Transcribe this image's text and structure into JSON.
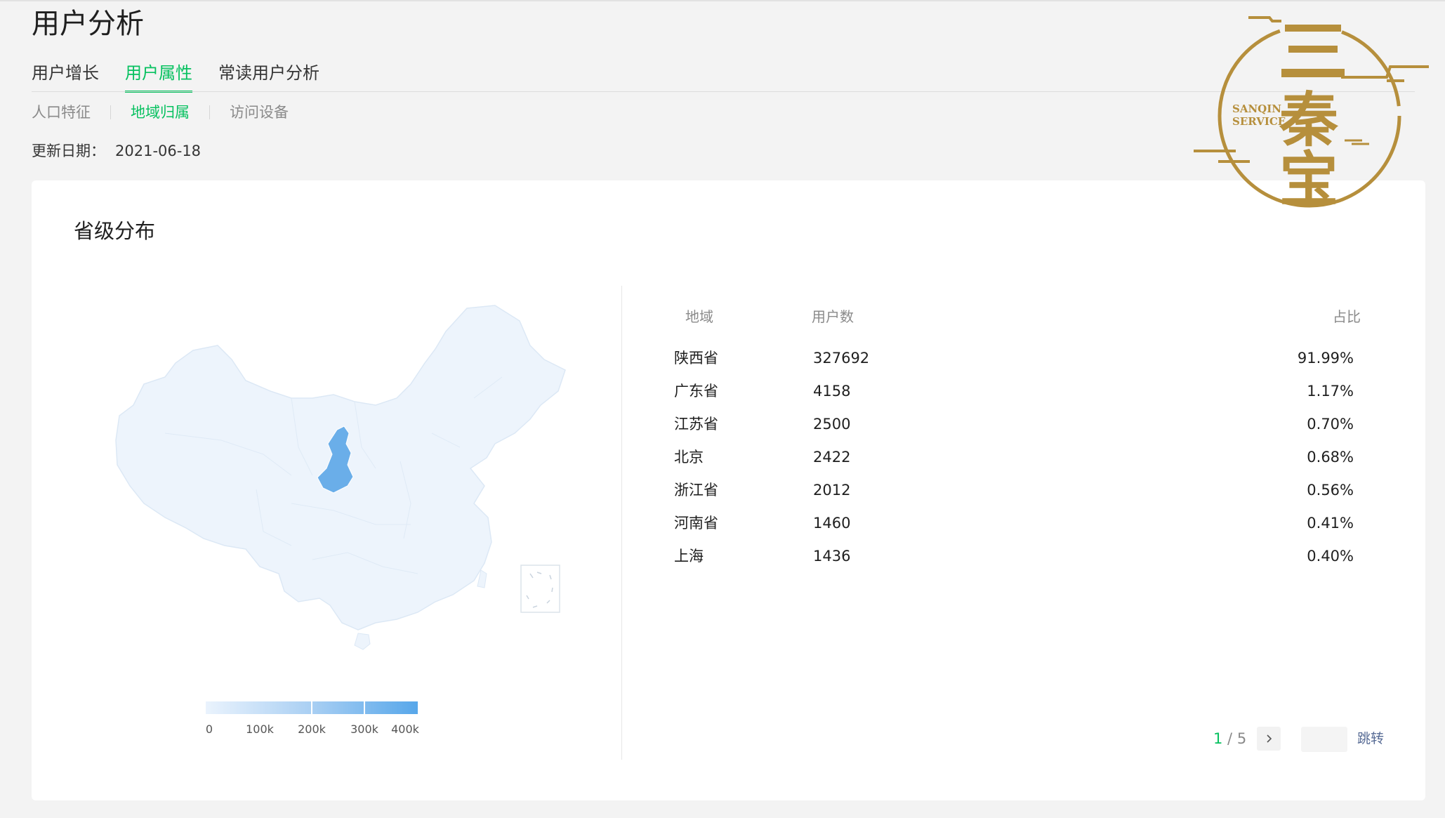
{
  "page": {
    "title": "用户分析"
  },
  "tabs": [
    {
      "label": "用户增长",
      "active": false
    },
    {
      "label": "用户属性",
      "active": true
    },
    {
      "label": "常读用户分析",
      "active": false
    }
  ],
  "subtabs": [
    {
      "label": "人口特征",
      "active": false
    },
    {
      "label": "地域归属",
      "active": true
    },
    {
      "label": "访问设备",
      "active": false
    }
  ],
  "update": {
    "label": "更新日期：",
    "date": "2021-06-18"
  },
  "card": {
    "title": "省级分布"
  },
  "map": {
    "highlighted_region": "陕西省",
    "legend_labels": [
      "0",
      "100k",
      "200k",
      "300k",
      "400k"
    ],
    "colors": {
      "low": "#eaf3fd",
      "high": "#57a7ea",
      "base": "#edf4fc"
    }
  },
  "table": {
    "headers": {
      "region": "地域",
      "users": "用户数",
      "share": "占比"
    },
    "rows": [
      {
        "region": "陕西省",
        "users": "327692",
        "share": "91.99%"
      },
      {
        "region": "广东省",
        "users": "4158",
        "share": "1.17%"
      },
      {
        "region": "江苏省",
        "users": "2500",
        "share": "0.70%"
      },
      {
        "region": "北京",
        "users": "2422",
        "share": "0.68%"
      },
      {
        "region": "浙江省",
        "users": "2012",
        "share": "0.56%"
      },
      {
        "region": "河南省",
        "users": "1460",
        "share": "0.41%"
      },
      {
        "region": "上海",
        "users": "1436",
        "share": "0.40%"
      }
    ]
  },
  "pagination": {
    "current": "1",
    "total": "5",
    "separator": " / ",
    "next_icon": "chevron-right-icon",
    "jump_label": "跳转"
  },
  "watermark": {
    "brand_text": "三秦宝",
    "en_line1": "SANQIN",
    "en_line2": "SERVICE"
  },
  "theme": {
    "accent": "#07c160",
    "link": "#576b95"
  }
}
